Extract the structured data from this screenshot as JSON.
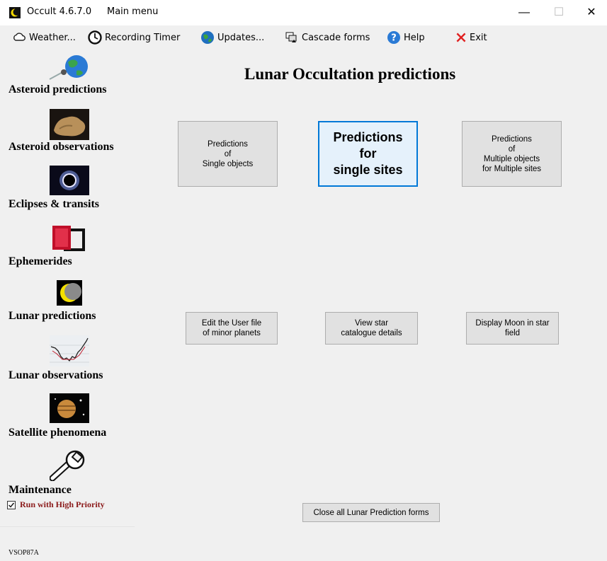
{
  "window": {
    "app_title": "Occult 4.6.7.0",
    "form_title": "Main menu",
    "minimize": "—",
    "maximize": "☐",
    "close": "✕"
  },
  "menubar": {
    "items": [
      {
        "label": "Weather...",
        "icon": "cloud-icon"
      },
      {
        "label": "Recording Timer",
        "icon": "clock-icon"
      },
      {
        "label": "Updates...",
        "icon": "globe-icon"
      },
      {
        "label": "Cascade forms",
        "icon": "cascade-icon"
      },
      {
        "label": "Help",
        "icon": "help-icon"
      },
      {
        "label": "Exit",
        "icon": "exit-icon"
      }
    ]
  },
  "sidebar": {
    "items": [
      {
        "label": "Asteroid predictions",
        "icon": "asteroid-globe-icon"
      },
      {
        "label": "Asteroid observations",
        "icon": "asteroid-rock-icon"
      },
      {
        "label": "Eclipses & transits",
        "icon": "eclipse-icon"
      },
      {
        "label": "Ephemerides",
        "icon": "ephemerides-book-icon"
      },
      {
        "label": "Lunar predictions",
        "icon": "moon-icon"
      },
      {
        "label": "Lunar observations",
        "icon": "light-curve-icon"
      },
      {
        "label": "Satellite phenomena",
        "icon": "jupiter-icon"
      },
      {
        "label": "Maintenance",
        "icon": "wrench-icon"
      }
    ],
    "priority_checkbox": {
      "label": "Run with High Priority",
      "checked": true
    }
  },
  "main": {
    "title": "Lunar Occultation predictions",
    "buttons": {
      "single_objects": "Predictions\nof\nSingle objects",
      "single_sites": "Predictions\nfor\nsingle sites",
      "multiple": "Predictions\nof\nMultiple objects\nfor Multiple sites",
      "edit_user_file": "Edit the User file\nof minor planets",
      "view_star": "View star\ncatalogue details",
      "display_moon": "Display Moon in star\nfield",
      "close_all": "Close all Lunar Prediction forms"
    }
  },
  "status": {
    "text": "VSOP87A"
  },
  "colors": {
    "accent": "#0078d7",
    "priority_label": "#8b1a1a",
    "background": "#f0f0f0"
  }
}
